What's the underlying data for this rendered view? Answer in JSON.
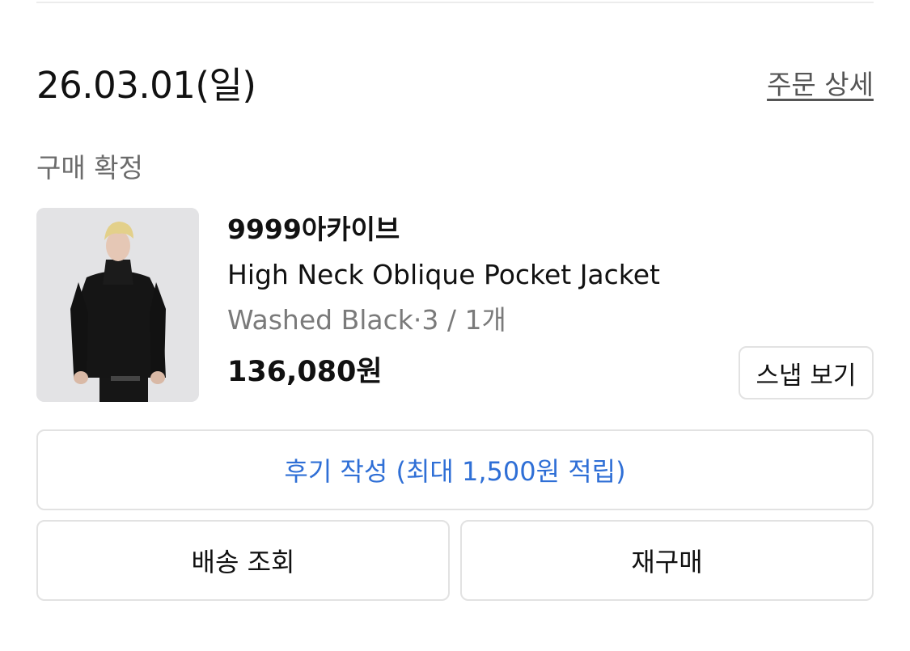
{
  "order": {
    "date": "26.03.01(일)",
    "detail_link": "주문 상세",
    "status": "구매 확정"
  },
  "product": {
    "brand": "9999아카이브",
    "name": "High Neck Oblique Pocket Jacket",
    "option": "Washed Black·3 / 1개",
    "price": "136,080원",
    "snap_label": "스냅 보기",
    "image_alt": "product-photo"
  },
  "actions": {
    "review_label": "후기 작성 (최대 1,500원 적립)",
    "delivery_label": "배송 조회",
    "rebuy_label": "재구매"
  },
  "colors": {
    "accent_blue": "#2f6fd6",
    "muted_text": "#7a7a7a",
    "border": "#e2e2e2"
  }
}
